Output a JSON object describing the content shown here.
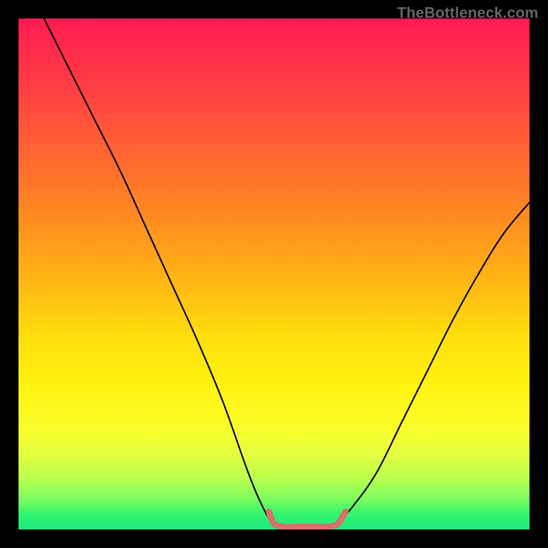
{
  "watermark": "TheBottleneck.com",
  "chart_data": {
    "type": "line",
    "title": "",
    "xlabel": "",
    "ylabel": "",
    "xlim": [
      0,
      100
    ],
    "ylim": [
      0,
      100
    ],
    "grid": false,
    "series": [
      {
        "name": "bottleneck-curve",
        "x": [
          5,
          10,
          15,
          20,
          25,
          30,
          35,
          40,
          45,
          48,
          50,
          52,
          55,
          57,
          60,
          62,
          65,
          70,
          75,
          80,
          85,
          90,
          95,
          100
        ],
        "y": [
          100,
          90,
          80,
          70,
          59,
          48,
          37,
          25,
          11,
          4,
          1,
          0,
          0,
          0,
          0,
          1,
          4,
          11,
          21,
          31,
          41,
          50,
          58,
          64
        ],
        "color": "#000000"
      },
      {
        "name": "optimal-zone-marker",
        "x": [
          49,
          50,
          52,
          55,
          58,
          60,
          62,
          63,
          64
        ],
        "y": [
          3.5,
          1.2,
          0.5,
          0.5,
          0.5,
          0.5,
          0.8,
          1.8,
          3.5
        ],
        "color": "#d9706a"
      }
    ],
    "background_gradient": {
      "direction": "vertical",
      "stops": [
        {
          "pos": 0.0,
          "color": "#ff1a52"
        },
        {
          "pos": 0.15,
          "color": "#ff4242"
        },
        {
          "pos": 0.4,
          "color": "#ff8f1f"
        },
        {
          "pos": 0.62,
          "color": "#ffde0d"
        },
        {
          "pos": 0.8,
          "color": "#fafd2a"
        },
        {
          "pos": 0.94,
          "color": "#7cfc5e"
        },
        {
          "pos": 1.0,
          "color": "#1ee880"
        }
      ]
    }
  }
}
